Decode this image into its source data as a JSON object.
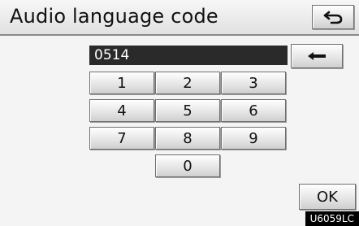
{
  "screen": {
    "title": "Audio language code",
    "back_icon": "return-arrow-icon",
    "display_value": "0514",
    "backspace_icon": "left-arrow-icon",
    "keys": [
      "1",
      "2",
      "3",
      "4",
      "5",
      "6",
      "7",
      "8",
      "9",
      "0"
    ],
    "ok_label": "OK"
  },
  "image_code": "U6059LC"
}
